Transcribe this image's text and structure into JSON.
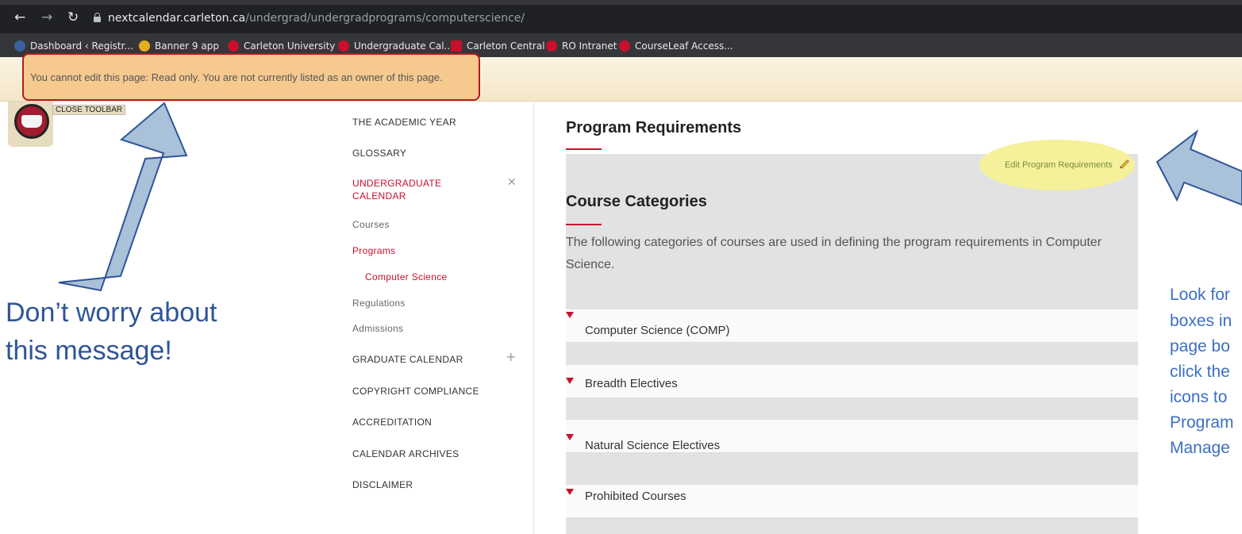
{
  "browser": {
    "url_host": "nextcalendar.carleton.ca",
    "url_path": "/undergrad/undergradprograms/computerscience/",
    "bookmarks": [
      {
        "label": "Dashboard ‹ Registr...",
        "color": "#3b5fa0"
      },
      {
        "label": "Banner 9 app",
        "color": "#e0b020"
      },
      {
        "label": "Carleton University",
        "color": "#c8102e"
      },
      {
        "label": "Undergraduate Cal...",
        "color": "#c8102e"
      },
      {
        "label": "Carleton Central",
        "color": "#c8102e"
      },
      {
        "label": "RO Intranet",
        "color": "#c8102e"
      },
      {
        "label": "CourseLeaf Access...",
        "color": "#c8102e"
      }
    ]
  },
  "toolbar": {
    "readonly_message": "You cannot edit this page: Read only. You are not currently listed as an owner of this page.",
    "close_label": "CLOSE TOOLBAR"
  },
  "sidebar": {
    "items": [
      {
        "label": "THE ACADEMIC YEAR"
      },
      {
        "label": "GLOSSARY"
      },
      {
        "label": "UNDERGRADUATE CALENDAR",
        "label_line1": "UNDERGRADUATE",
        "label_line2": "CALENDAR",
        "sign": "✕"
      },
      {
        "label": "Courses"
      },
      {
        "label": "Programs"
      },
      {
        "label": "Computer Science"
      },
      {
        "label": "Regulations"
      },
      {
        "label": "Admissions"
      },
      {
        "label": "GRADUATE CALENDAR",
        "sign": "+"
      },
      {
        "label": "COPYRIGHT COMPLIANCE"
      },
      {
        "label": "ACCREDITATION"
      },
      {
        "label": "CALENDAR ARCHIVES"
      },
      {
        "label": "DISCLAIMER"
      }
    ]
  },
  "main": {
    "title": "Program Requirements",
    "edit_link": "Edit Program Requirements",
    "section_title": "Course Categories",
    "section_text": "The following categories of courses are used in defining the program requirements in Computer Science.",
    "categories": [
      {
        "label": "Computer Science (COMP)"
      },
      {
        "label": "Breadth Electives"
      },
      {
        "label": "Natural Science Electives"
      },
      {
        "label": "Prohibited Courses"
      }
    ]
  },
  "annotations": {
    "left_line1": "Don’t worry about",
    "left_line2": "this message!",
    "right_lines": [
      "Look for",
      "boxes in",
      "page bo",
      "click the",
      "icons to",
      "Program",
      "Manage"
    ]
  },
  "colors": {
    "accent_red": "#c8102e",
    "annotation_blue": "#2f5597",
    "arrow_fill": "#a9c1d9"
  }
}
